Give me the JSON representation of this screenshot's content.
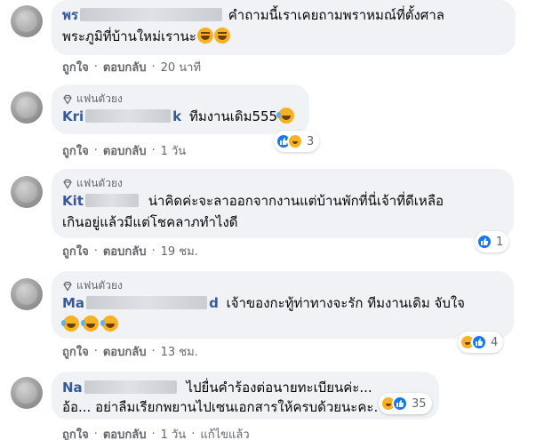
{
  "ui": {
    "like_label": "ถูกใจ",
    "reply_label": "ตอบกลับ",
    "edited_label": "แก้ไขแล้ว",
    "separator": "·"
  },
  "colors": {
    "bubble": "#f0f2f5",
    "name": "#385898",
    "meta": "#65676b",
    "like": "#1877f2",
    "haha": "#f7b125"
  },
  "comments": [
    {
      "badge": "",
      "name_prefix": "พร",
      "name_suffix": "",
      "text_lines": [
        "คำถามนี้เราเคยถามพราหมณ์ที่ตั้งศาล",
        "พระภูมิที่บ้านใหม่เรานะ"
      ],
      "emojis": [
        "grin-icon",
        "grin-icon"
      ],
      "time": "20 นาที",
      "reactions": null
    },
    {
      "badge": "แฟนตัวยง",
      "name_prefix": "Kri",
      "name_suffix": "k",
      "text_lines": [
        "ทีมงานเดิม555"
      ],
      "emojis": [
        "laugh-icon"
      ],
      "time": "1 วัน",
      "reactions": {
        "icons": [
          "like-icon",
          "haha-icon"
        ],
        "count": "3"
      }
    },
    {
      "badge": "แฟนตัวยง",
      "name_prefix": "Kit",
      "name_suffix": "",
      "text_lines": [
        "น่าคิดค่ะจะลาออกจากงานแต่บ้านพักที่นี่เจ้าที่ดีเหลือ",
        "เกินอยู่แล้วมีแต่โชคลาภทำไงดี"
      ],
      "emojis": [],
      "time": "19 ชม.",
      "reactions": {
        "icons": [
          "like-icon"
        ],
        "count": "1"
      }
    },
    {
      "badge": "แฟนตัวยง",
      "name_prefix": "Ma",
      "name_suffix": "d",
      "text_lines": [
        "เจ้าของกะทู้ท่าทางจะรัก ทีมงานเดิม จับใจ",
        ""
      ],
      "emojis": [
        "laugh-icon",
        "laugh-icon",
        "laugh-icon"
      ],
      "time": "13 ชม.",
      "reactions": {
        "icons": [
          "haha-icon",
          "like-icon"
        ],
        "count": "4"
      }
    },
    {
      "badge": "",
      "name_prefix": "Na",
      "name_suffix": "",
      "text_lines": [
        "ไปยื่นคำร้องต่อนายทะเบียนค่ะ...",
        "อ้อ... อย่าลืมเรียกพยานไปเซนเอกสารให้ครบด้วยนะคะ."
      ],
      "emojis": [],
      "time": "1 วัน",
      "reactions": {
        "icons": [
          "haha-icon",
          "like-icon"
        ],
        "count": "35"
      }
    }
  ]
}
